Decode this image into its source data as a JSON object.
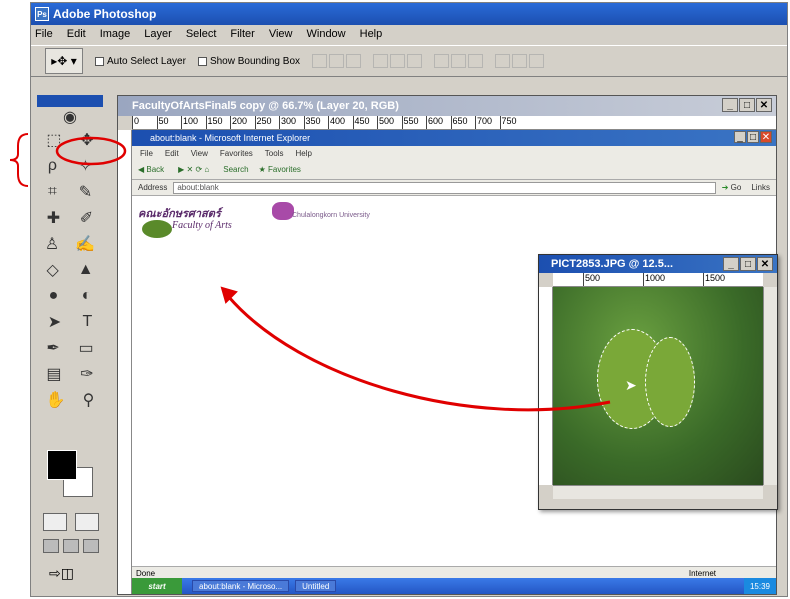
{
  "app": {
    "title": "Adobe Photoshop"
  },
  "menu": [
    "File",
    "Edit",
    "Image",
    "Layer",
    "Select",
    "Filter",
    "View",
    "Window",
    "Help"
  ],
  "options": {
    "auto_select": "Auto Select Layer",
    "bounding_box": "Show Bounding Box"
  },
  "document": {
    "title": "FacultyOfArtsFinal5 copy @ 66.7% (Layer 20, RGB)",
    "ruler": [
      "0",
      "50",
      "100",
      "150",
      "200",
      "250",
      "300",
      "350",
      "400",
      "450",
      "500",
      "550",
      "600",
      "650",
      "700",
      "750"
    ]
  },
  "browser": {
    "title": "about:blank - Microsoft Internet Explorer",
    "menu": [
      "File",
      "Edit",
      "View",
      "Favorites",
      "Tools",
      "Help"
    ],
    "back": "Back",
    "search": "Search",
    "favorites": "Favorites",
    "address_label": "Address",
    "address": "about:blank",
    "go": "Go",
    "links": "Links",
    "logo_thai": "คณะอักษรศาสตร์",
    "logo_en": "Faculty of Arts",
    "logo_right": "Chulalongkorn University",
    "status": "Done",
    "zone": "Internet",
    "start": "start",
    "task1": "about:blank - Microso...",
    "task2": "Untitled",
    "clock": "15:39"
  },
  "image_window": {
    "title": "PICT2853.JPG @ 12.5...",
    "ruler": [
      "500",
      "1000",
      "1500"
    ]
  },
  "colors": {
    "accent": "#1c4fb0",
    "annotation": "#e00000"
  },
  "icons": [
    "photoshop-logo-icon",
    "move-tool-icon",
    "marquee-icon",
    "lasso-icon",
    "magic-wand-icon",
    "crop-icon",
    "slice-icon",
    "healing-brush-icon",
    "brush-icon",
    "clone-stamp-icon",
    "history-brush-icon",
    "eraser-icon",
    "gradient-icon",
    "dodge-icon",
    "path-selection-icon",
    "type-icon",
    "pen-icon",
    "shape-icon",
    "notes-icon",
    "eyedropper-icon",
    "hand-icon",
    "zoom-icon"
  ]
}
